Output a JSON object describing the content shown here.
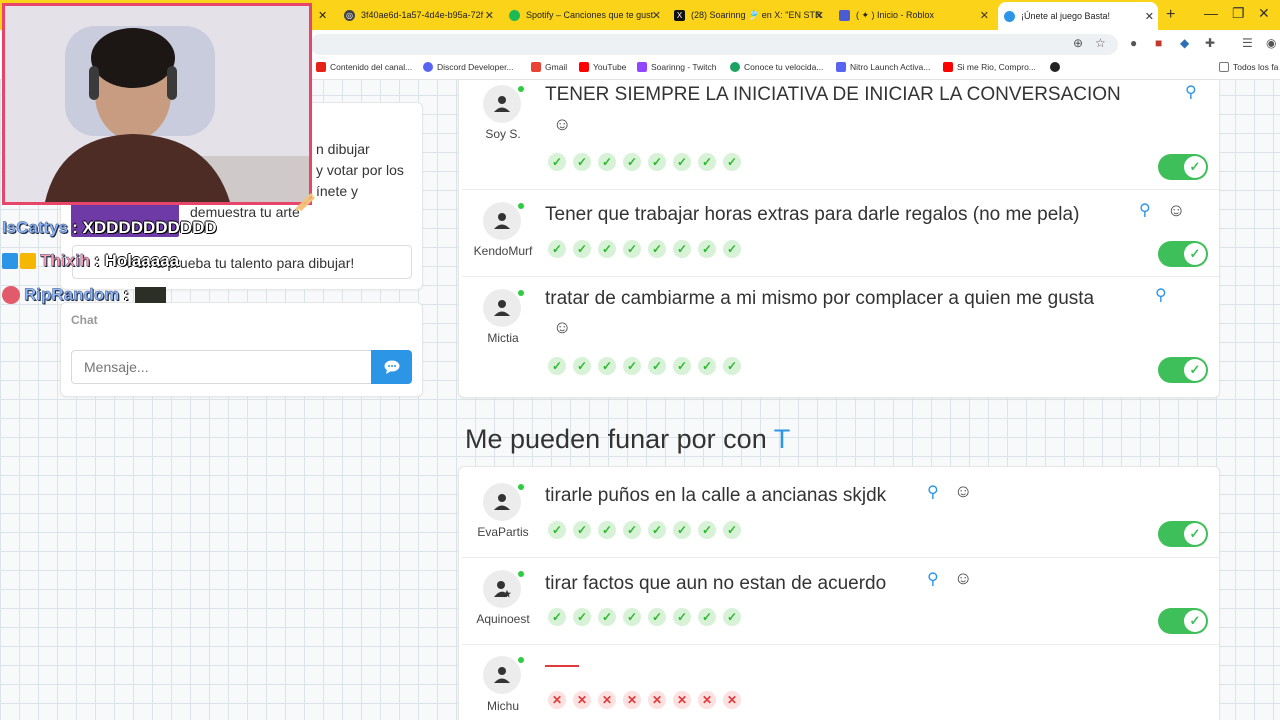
{
  "browser": {
    "tabs": [
      {
        "label": "3f40ae6d-1a57-4d4e-b95a-72f",
        "fav_color": "#444444"
      },
      {
        "label": "Spotify – Canciones que te gust",
        "fav_color": "#1db954"
      },
      {
        "label": "(28) Soarinng 🎐 en X: \"EN STR",
        "fav_color": "#111111"
      },
      {
        "label": "( ✦ ) Inicio - Roblox",
        "fav_color": "#4a5bd4"
      },
      {
        "label": "¡Únete al juego Basta!",
        "fav_color": "#2d95e6"
      }
    ],
    "bookmarks": [
      {
        "label": "Contenido del canal...",
        "fav_color": "#e62117"
      },
      {
        "label": "Discord Developer...",
        "fav_color": "#5865f2"
      },
      {
        "label": "Gmail",
        "fav_color": "#ea4335"
      },
      {
        "label": "YouTube",
        "fav_color": "#ff0000"
      },
      {
        "label": "Soarinng - Twitch",
        "fav_color": "#9146ff"
      },
      {
        "label": "Conoce tu velocida...",
        "fav_color": "#1aa260"
      },
      {
        "label": "Nitro Launch Activa...",
        "fav_color": "#5865f2"
      },
      {
        "label": "Si me Rio, Compro...",
        "fav_color": "#ff0000"
      },
      {
        "label": "Todos los fa",
        "fav_color": "#555555"
      }
    ]
  },
  "left_panel": {
    "description_lines": [
      "n dibujar",
      "y votar por los",
      "ínete y",
      "demuestra tu arte"
    ],
    "promo_text": "Pon a prueba tu talento para dibujar!",
    "chat_label": "Chat",
    "message_placeholder": "Mensaje..."
  },
  "stream_chat": [
    {
      "user": "IsCattys",
      "message": ": XDDDDDDDDDD"
    },
    {
      "user": "Thixih",
      "message": ": Holaaaaa"
    },
    {
      "user": "RipRandom",
      "message": ":"
    }
  ],
  "answers_top": [
    {
      "user": "Soy S.",
      "text": "TENER SIEMPRE LA INICIATIVA DE INICIAR LA CONVERSACION",
      "votes": 8,
      "valid": true
    },
    {
      "user": "KendoMurf",
      "text": "Tener que trabajar horas extras para darle regalos (no me pela)",
      "votes": 8,
      "valid": true
    },
    {
      "user": "Mictia",
      "text": "tratar de cambiarme a mi mismo por complacer a quien me gusta",
      "votes": 8,
      "valid": true
    }
  ],
  "section": {
    "title": "Me pueden funar por con",
    "letter": "T"
  },
  "answers_bottom": [
    {
      "user": "EvaPartis",
      "text": "tirarle puños en la calle a ancianas skjdk",
      "votes": 8,
      "valid": true
    },
    {
      "user": "Aquinoest",
      "text": "tirar factos que aun no estan de acuerdo",
      "votes": 8,
      "valid": true
    },
    {
      "user": "Michu",
      "text": "",
      "votes": 8,
      "valid": false
    }
  ],
  "colors": {
    "accent": "#2d95e6",
    "valid": "#3fbf5a",
    "invalid": "#e03a3a",
    "tabbar": "#fbd41a"
  }
}
